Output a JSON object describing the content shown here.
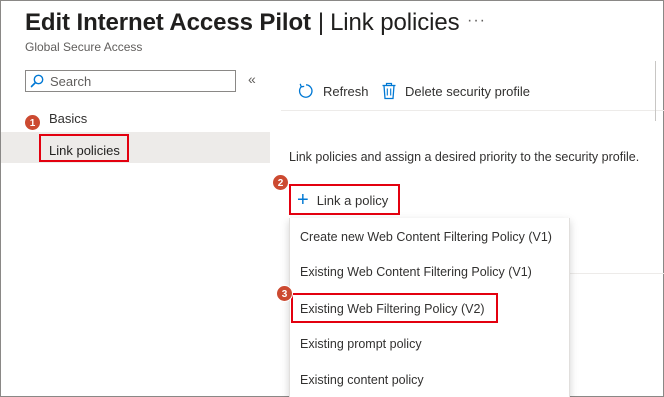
{
  "header": {
    "title_main": "Edit Internet Access Pilot",
    "title_separator": "|",
    "title_section": "Link policies",
    "more_label": "···",
    "subtitle": "Global Secure Access"
  },
  "sidebar": {
    "search_placeholder": "Search",
    "collapse_label": "«",
    "items": [
      {
        "label": "Basics"
      },
      {
        "label": "Link policies",
        "selected": true
      }
    ]
  },
  "toolbar": {
    "refresh_label": "Refresh",
    "delete_label": "Delete security profile"
  },
  "main": {
    "description": "Link policies and assign a desired priority to the security profile.",
    "link_button_label": "Link a policy",
    "dropdown": [
      "Create new Web Content Filtering Policy (V1)",
      "Existing Web Content Filtering Policy (V1)",
      "Existing Web Filtering Policy (V2)",
      "Existing prompt policy",
      "Existing content policy"
    ]
  },
  "annotations": {
    "badge_1": "1",
    "badge_2": "2",
    "badge_3": "3",
    "badge_color": "#cc4a31",
    "highlight_color": "#e3000f"
  },
  "colors": {
    "accent": "#0078d4",
    "selected_bg": "#edebe9"
  }
}
